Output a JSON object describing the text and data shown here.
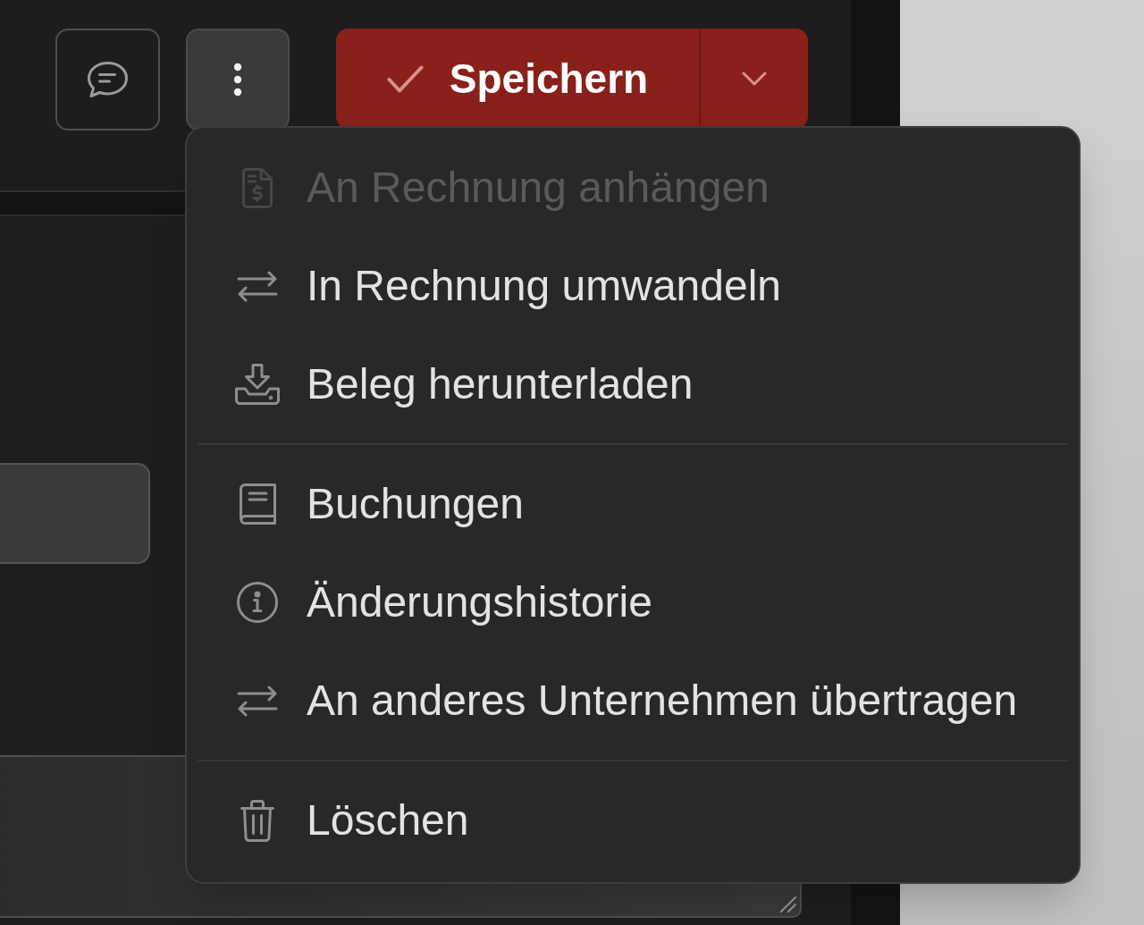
{
  "toolbar": {
    "more_button": {
      "expanded": true
    },
    "save_button": {
      "label": "Speichern"
    }
  },
  "menu": {
    "groups": [
      {
        "items": [
          {
            "label": "An Rechnung anhängen",
            "disabled": true
          },
          {
            "label": "In Rechnung umwandeln",
            "disabled": false
          },
          {
            "label": "Beleg herunterladen",
            "disabled": false
          }
        ]
      },
      {
        "items": [
          {
            "label": "Buchungen",
            "disabled": false
          },
          {
            "label": "Änderungshistorie",
            "disabled": false
          },
          {
            "label": "An anderes Unternehmen übertragen",
            "disabled": false
          }
        ]
      },
      {
        "items": [
          {
            "label": "Löschen",
            "disabled": false
          }
        ]
      }
    ]
  }
}
